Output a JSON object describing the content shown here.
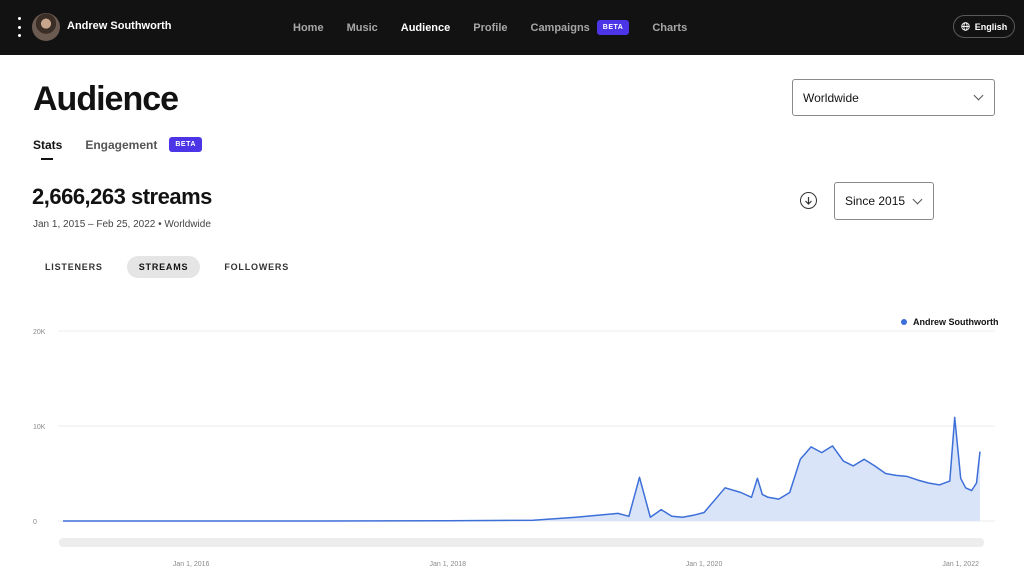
{
  "topbar": {
    "artist_name": "Andrew Southworth",
    "nav": [
      {
        "label": "Home",
        "active": false
      },
      {
        "label": "Music",
        "active": false
      },
      {
        "label": "Audience",
        "active": true
      },
      {
        "label": "Profile",
        "active": false
      },
      {
        "label": "Campaigns",
        "active": false,
        "badge": "BETA"
      },
      {
        "label": "Charts",
        "active": false
      }
    ],
    "language": "English"
  },
  "header": {
    "title": "Audience",
    "region": "Worldwide"
  },
  "subtabs": {
    "stats": "Stats",
    "engagement": "Engagement",
    "engagement_badge": "BETA"
  },
  "stats": {
    "total": "2,666,263 streams",
    "date_range": "Jan 1, 2015 – Feb 25, 2022 • Worldwide",
    "period": "Since 2015"
  },
  "metric_tabs": [
    "LISTENERS",
    "STREAMS",
    "FOLLOWERS"
  ],
  "metric_active": "STREAMS",
  "colors": {
    "accent": "#4c35e6",
    "series": "#3d6fd8",
    "fill": "#d9e4f9"
  },
  "chart_data": {
    "type": "area",
    "title": "",
    "xlabel": "",
    "ylabel": "",
    "ylim": [
      0,
      20000
    ],
    "ytick_labels": [
      "0",
      "10K",
      "20K"
    ],
    "yticks": [
      0,
      10000,
      20000
    ],
    "xtick_labels": [
      "Jan 1, 2016",
      "Jan 1, 2018",
      "Jan 1, 2020",
      "Jan 1, 2022"
    ],
    "xticks": [
      "2016-01-01",
      "2018-01-01",
      "2020-01-01",
      "2022-01-01"
    ],
    "xlim": [
      "2015-01-01",
      "2022-02-25"
    ],
    "legend_position": "top-right",
    "grid": true,
    "series": [
      {
        "name": "Andrew Southworth",
        "x": [
          "2015-01-01",
          "2016-01-01",
          "2017-01-01",
          "2018-01-01",
          "2018-09-01",
          "2019-01-01",
          "2019-05-01",
          "2019-06-01",
          "2019-07-01",
          "2019-08-01",
          "2019-09-01",
          "2019-10-01",
          "2019-11-01",
          "2019-12-01",
          "2020-01-01",
          "2020-03-01",
          "2020-04-15",
          "2020-05-15",
          "2020-06-01",
          "2020-06-15",
          "2020-07-01",
          "2020-08-01",
          "2020-09-01",
          "2020-10-01",
          "2020-11-01",
          "2020-12-01",
          "2021-01-01",
          "2021-02-01",
          "2021-03-01",
          "2021-04-01",
          "2021-05-01",
          "2021-06-01",
          "2021-07-01",
          "2021-08-01",
          "2021-09-01",
          "2021-10-01",
          "2021-11-01",
          "2021-12-01",
          "2021-12-15",
          "2022-01-01",
          "2022-01-15",
          "2022-02-01",
          "2022-02-15",
          "2022-02-25"
        ],
        "values": [
          0,
          0,
          0,
          20,
          80,
          400,
          800,
          500,
          4600,
          400,
          1200,
          500,
          400,
          600,
          900,
          3500,
          3000,
          2500,
          4500,
          2800,
          2500,
          2300,
          3000,
          6500,
          7800,
          7200,
          7900,
          6300,
          5800,
          6500,
          5800,
          5000,
          4800,
          4700,
          4300,
          4000,
          3800,
          4200,
          10900,
          4500,
          3500,
          3200,
          4000,
          7300
        ]
      }
    ]
  }
}
